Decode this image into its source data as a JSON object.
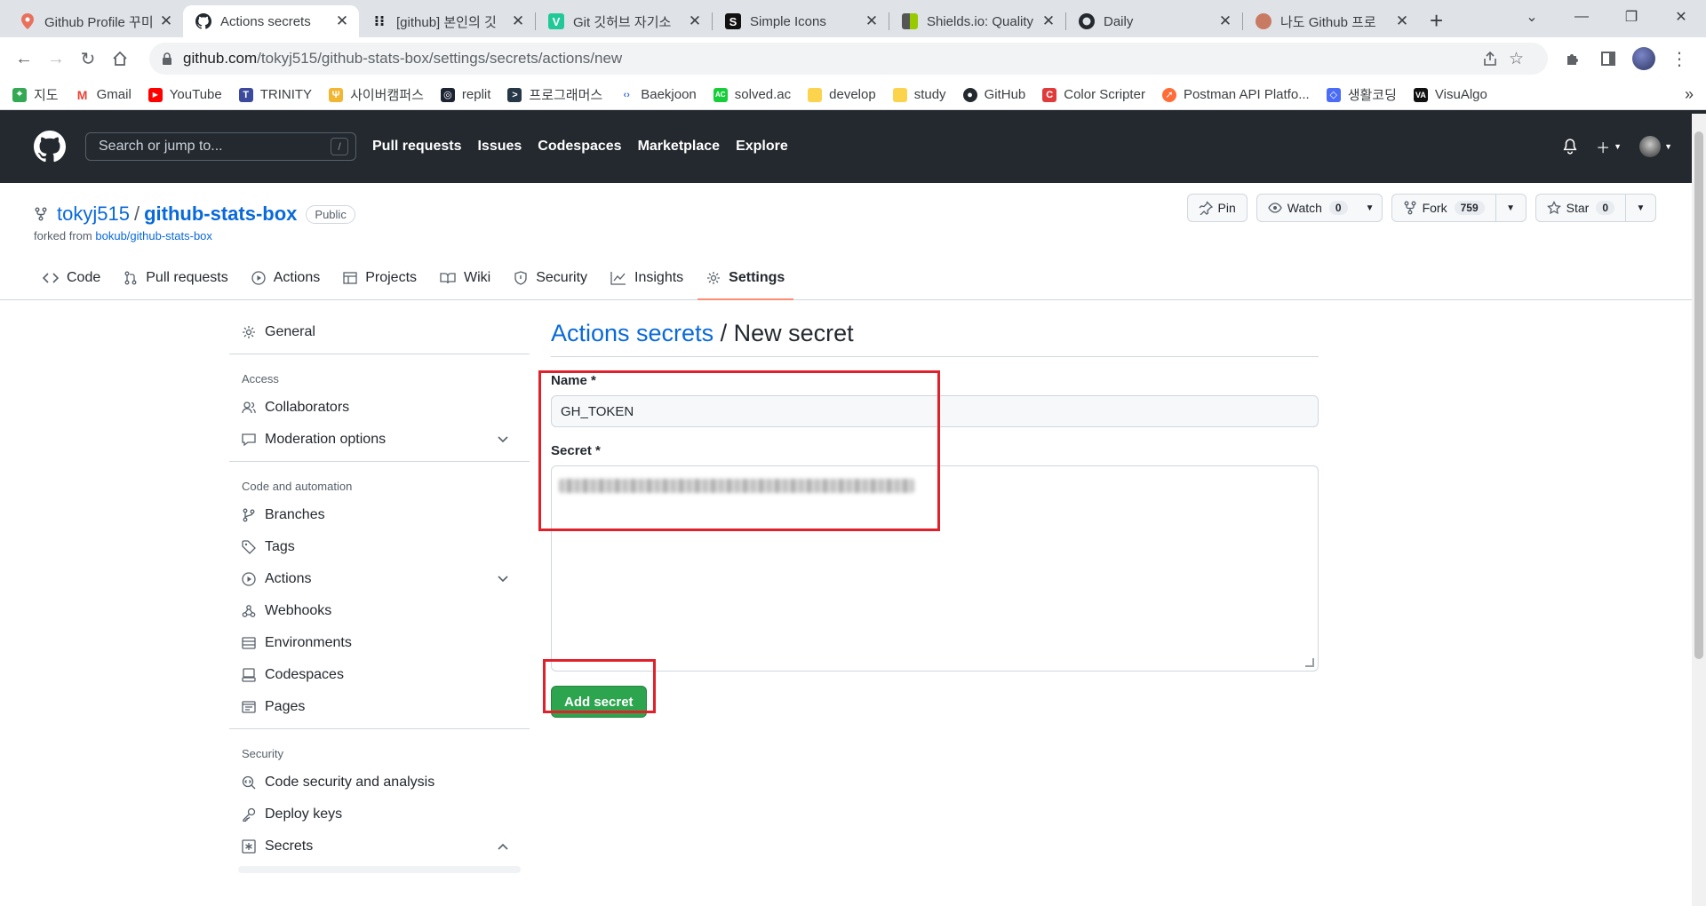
{
  "browser": {
    "tabs": [
      {
        "title": "Github Profile 꾸미",
        "icon": "pin-icon",
        "active": false
      },
      {
        "title": "Actions secrets",
        "icon": "github-icon",
        "active": true
      },
      {
        "title": "[github] 본인의 깃",
        "icon": "dots-icon",
        "active": false
      },
      {
        "title": "Git 깃허브 자기소",
        "icon": "v-icon",
        "active": false
      },
      {
        "title": "Simple Icons",
        "icon": "simpleicons-icon",
        "active": false
      },
      {
        "title": "Shields.io: Quality",
        "icon": "shields-icon",
        "active": false
      },
      {
        "title": "Daily",
        "icon": "github-icon",
        "active": false
      },
      {
        "title": "나도 Github 프로",
        "icon": "avatar-icon",
        "active": false
      }
    ],
    "url_host": "github.com",
    "url_path": "/tokyj515/github-stats-box/settings/secrets/actions/new",
    "bookmarks": [
      "지도",
      "Gmail",
      "YouTube",
      "TRINITY",
      "사이버캠퍼스",
      "replit",
      "프로그래머스",
      "Baekjoon",
      "solved.ac",
      "develop",
      "study",
      "GitHub",
      "Color Scripter",
      "Postman API Platfo...",
      "생활코딩",
      "VisuAlgo"
    ],
    "bookmarks_more": "»"
  },
  "gh": {
    "search_placeholder": "Search or jump to...",
    "search_key": "/",
    "nav": [
      "Pull requests",
      "Issues",
      "Codespaces",
      "Marketplace",
      "Explore"
    ]
  },
  "repo": {
    "owner": "tokyj515",
    "separator": "/",
    "name": "github-stats-box",
    "visibility": "Public",
    "forked_prefix": "forked from",
    "forked_from": "bokub/github-stats-box",
    "pin_label": "Pin",
    "watch_label": "Watch",
    "watch_count": "0",
    "fork_label": "Fork",
    "fork_count": "759",
    "star_label": "Star",
    "star_count": "0",
    "tabs": [
      "Code",
      "Pull requests",
      "Actions",
      "Projects",
      "Wiki",
      "Security",
      "Insights",
      "Settings"
    ]
  },
  "sidebar": {
    "general": "General",
    "access_heading": "Access",
    "collaborators": "Collaborators",
    "moderation": "Moderation options",
    "code_heading": "Code and automation",
    "branches": "Branches",
    "tags": "Tags",
    "actions": "Actions",
    "webhooks": "Webhooks",
    "environments": "Environments",
    "codespaces": "Codespaces",
    "pages": "Pages",
    "security_heading": "Security",
    "code_security": "Code security and analysis",
    "deploy_keys": "Deploy keys",
    "secrets": "Secrets"
  },
  "form": {
    "breadcrumb": "Actions secrets",
    "title_sep": " / ",
    "title": "New secret",
    "name_label": "Name *",
    "name_value": "GH_TOKEN",
    "secret_label": "Secret *",
    "submit_label": "Add secret"
  },
  "colors": {
    "header_bg": "#24292f",
    "link": "#0969da",
    "primary_button": "#2da44e",
    "highlight": "#e0202a",
    "active_tab_underline": "#fd8c73"
  }
}
